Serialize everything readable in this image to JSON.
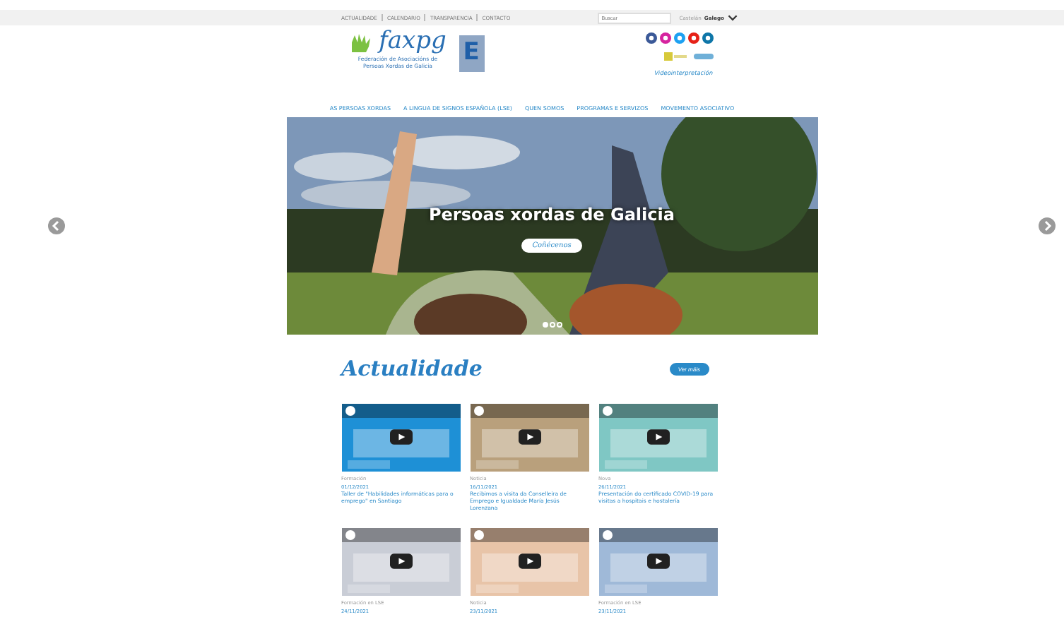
{
  "top_bar": {
    "links": [
      "ACTUALIDADE",
      "CALENDARIO",
      "TRANSPARENCIA",
      "CONTACTO"
    ],
    "search": {
      "placeholder": "Buscar"
    },
    "languages": [
      {
        "label": "Castelán",
        "selected": false
      },
      {
        "label": "Galego",
        "selected": true
      }
    ]
  },
  "header": {
    "logo_text": "faxpg",
    "logo_subtitle": "Federación de Asociacións de Persoas Xordas de Galicia",
    "badge": "E",
    "social": [
      {
        "color": "#3b5998"
      },
      {
        "color": "#d6249f"
      },
      {
        "color": "#1da1f2"
      },
      {
        "color": "#e62117"
      },
      {
        "color": "#0e76a8"
      }
    ],
    "video_link": "Videointerpretación"
  },
  "nav": [
    "AS PERSOAS XORDAS",
    "A LINGUA DE SIGNOS ESPAÑOLA (LSE)",
    "QUEN SOMOS",
    "PROGRAMAS E SERVIZOS",
    "MOVEMENTO ASOCIATIVO"
  ],
  "hero": {
    "kind": "picture",
    "title": "Persoas xordas de Galicia",
    "button": "Coñécenos",
    "slides": [
      {
        "selected": true
      },
      {
        "selected": false
      },
      {
        "selected": false
      }
    ]
  },
  "news": {
    "title": "Actualidade",
    "more_button": "Ver máis",
    "items": [
      {
        "category": "Formación",
        "date": "01/12/2021",
        "title": "Taller de \"Habilidades informáticas para o emprego\" en Santiago"
      },
      {
        "category": "Noticia",
        "date": "16/11/2021",
        "title": "Recibimos a visita da Conselleira de Emprego e Igualdade María Jesús Lorenzana"
      },
      {
        "category": "Nova",
        "date": "26/11/2021",
        "title": "Presentación do certificado COVID-19 para visitas a hospitais e hostalería"
      },
      {
        "category": "Formación en LSE",
        "date": "24/11/2021"
      },
      {
        "category": "Noticia",
        "date": "23/11/2021"
      },
      {
        "category": "Formación en LSE",
        "date": "23/11/2021"
      }
    ]
  }
}
